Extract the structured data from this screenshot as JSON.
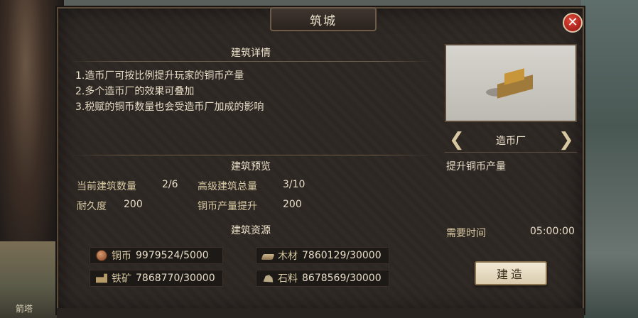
{
  "window": {
    "title": "筑城",
    "close_glyph": "✕"
  },
  "background": {
    "map_label": "箭塔"
  },
  "details": {
    "heading": "建筑详情",
    "lines": [
      "1.造币厂可按比例提升玩家的铜币产量",
      "2.多个造币厂的效果可叠加",
      "3.税赋的铜币数量也会受造币厂加成的影响"
    ]
  },
  "preview": {
    "heading": "建筑预览",
    "current_count_label": "当前建筑数量",
    "current_count_value": "2/6",
    "advanced_total_label": "高级建筑总量",
    "advanced_total_value": "3/10",
    "durability_label": "耐久度",
    "durability_value": "200",
    "copper_boost_label": "铜币产量提升",
    "copper_boost_value": "200"
  },
  "resources": {
    "heading": "建筑资源",
    "items": [
      {
        "icon": "copper-coin-icon",
        "name": "铜币",
        "value": "9979524/5000"
      },
      {
        "icon": "wood-icon",
        "name": "木材",
        "value": "7860129/30000"
      },
      {
        "icon": "iron-ore-icon",
        "name": "铁矿",
        "value": "7868770/30000"
      },
      {
        "icon": "stone-icon",
        "name": "石料",
        "value": "8678569/30000"
      }
    ]
  },
  "building": {
    "name": "造币厂",
    "effect": "提升铜币产量",
    "time_label": "需要时间",
    "time_value": "05:00:00",
    "build_button": "建造",
    "prev_glyph": "❮",
    "next_glyph": "❯"
  },
  "colors": {
    "panel_bg": "#2d2723",
    "accent_text": "#d8c9a2",
    "close_red": "#a8201a",
    "button_bg": "#f2ead6"
  }
}
